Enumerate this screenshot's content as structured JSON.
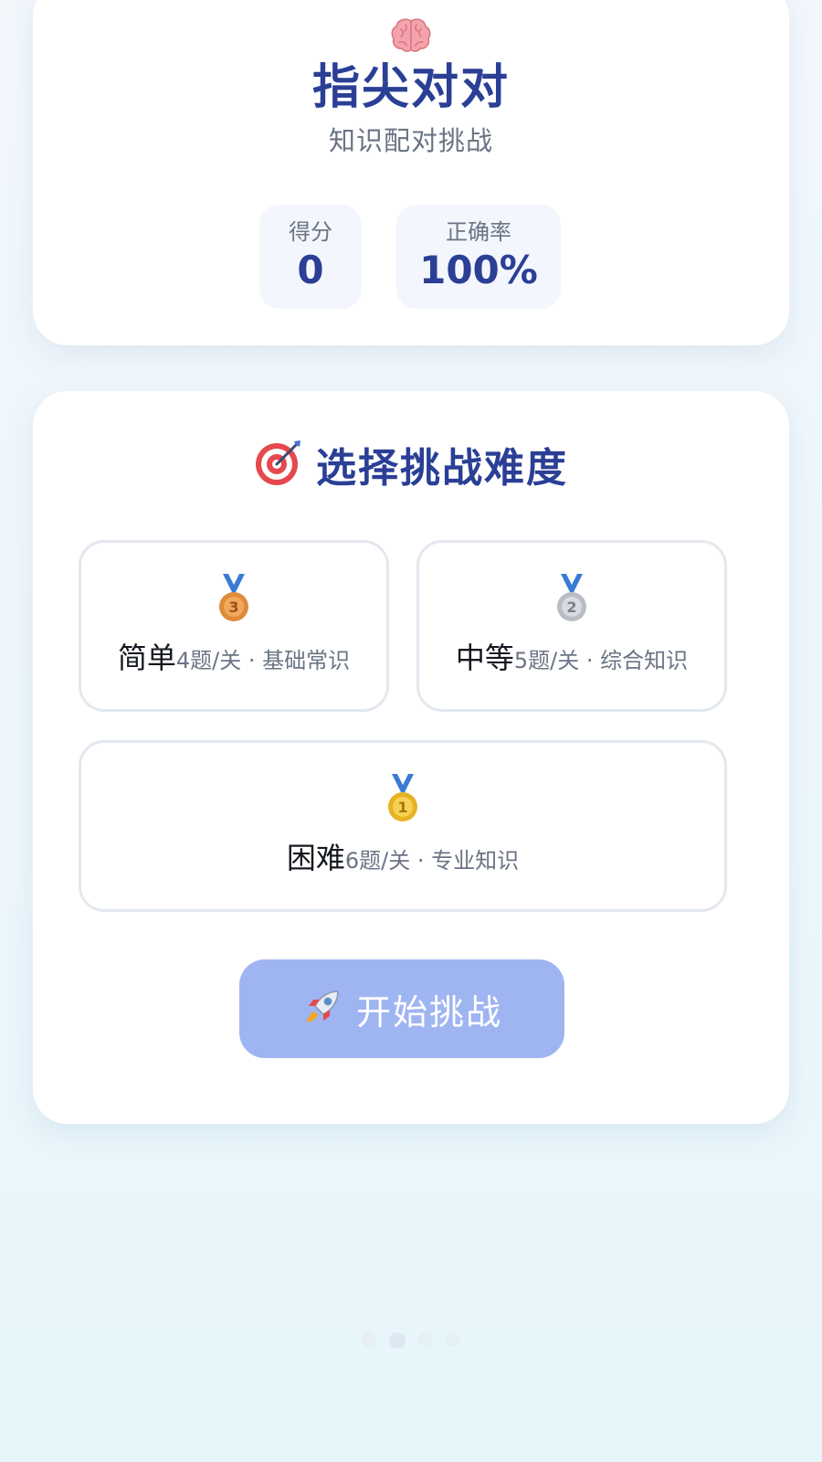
{
  "header": {
    "icon": "brain-icon",
    "title": "指尖对对",
    "subtitle": "知识配对挑战",
    "stats": [
      {
        "label": "得分",
        "value": "0"
      },
      {
        "label": "正确率",
        "value": "100%"
      }
    ]
  },
  "difficulty": {
    "icon": "target-icon",
    "title": "选择挑战难度",
    "options": [
      {
        "icon": "bronze-medal-icon",
        "name": "简单",
        "desc": "4题/关 · 基础常识"
      },
      {
        "icon": "silver-medal-icon",
        "name": "中等",
        "desc": "5题/关 · 综合知识"
      },
      {
        "icon": "gold-medal-icon",
        "name": "困难",
        "desc": "6题/关 · 专业知识"
      }
    ],
    "start_button": {
      "icon": "rocket-icon",
      "label": "开始挑战"
    }
  },
  "pager": {
    "count": 4,
    "active_index": 1
  },
  "colors": {
    "title_blue": "#2a3f95",
    "muted_text": "#6b7485",
    "start_button_bg": "#9fb5f2",
    "option_border": "#e3e8ef"
  }
}
